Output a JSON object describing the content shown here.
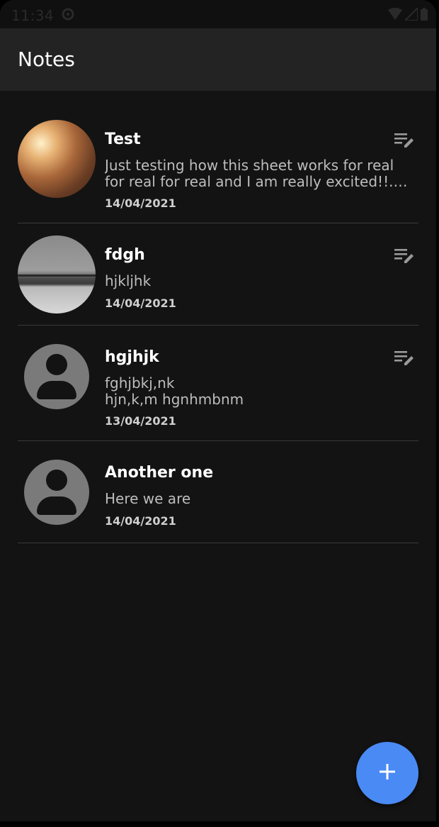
{
  "status_bar": {
    "time": "11:34",
    "icons": [
      "sync-icon",
      "wifi-icon",
      "signal-icon",
      "battery-icon"
    ]
  },
  "app_bar": {
    "title": "Notes"
  },
  "notes": [
    {
      "title": "Test",
      "body": "Just testing how this sheet works for real for real for real and I am really excited!!. It...",
      "date": "14/04/2021",
      "avatar": "photo",
      "has_edit": true
    },
    {
      "title": "fdgh",
      "body": "hjkljhk",
      "date": "14/04/2021",
      "avatar": "photo",
      "has_edit": true
    },
    {
      "title": "hgjhjk",
      "body": "fghjbkj,nk\nhjn,k,m hgnhmbnm",
      "date": "13/04/2021",
      "avatar": "person-placeholder",
      "has_edit": true
    },
    {
      "title": "Another one",
      "body": "Here we are",
      "date": "14/04/2021",
      "avatar": "person-placeholder",
      "has_edit": false
    }
  ],
  "fab": {
    "icon": "plus-icon"
  },
  "colors": {
    "background": "#131313",
    "app_bar": "#232323",
    "accent": "#4a8af4",
    "divider": "#3a3a3a"
  }
}
